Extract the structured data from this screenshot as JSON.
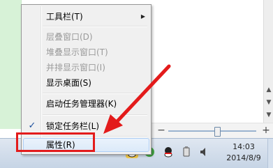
{
  "menu": {
    "items": [
      {
        "label": "工具栏(T)",
        "disabled": false,
        "has_submenu": true
      },
      {
        "label": "层叠窗口(D)",
        "disabled": true
      },
      {
        "label": "堆叠显示窗口(T)",
        "disabled": true
      },
      {
        "label": "并排显示窗口(I)",
        "disabled": true
      },
      {
        "label": "显示桌面(S)",
        "disabled": false
      },
      {
        "label": "启动任务管理器(K)",
        "disabled": false
      },
      {
        "label": "锁定任务栏(L)",
        "disabled": false,
        "checked": true
      },
      {
        "label": "属性(R)",
        "disabled": false,
        "highlighted": true
      }
    ],
    "submenu_glyph": "▶",
    "check_glyph": "✓"
  },
  "taskbar": {
    "clock_time": "14:03",
    "clock_date": "2014/8/9",
    "tray_icons": [
      "qq-icon",
      "qq-icon",
      "usb-device-icon",
      "volume-icon",
      "input-method-icon",
      "shield-icon"
    ]
  },
  "scroll": {
    "up_glyph": "▲",
    "down_glyph": "▼"
  },
  "slider": {
    "minus_glyph": "−",
    "plus_glyph": "+"
  },
  "annotation_colors": {
    "highlight_box": "#e31b1b",
    "arrow": "#e31b1b"
  }
}
